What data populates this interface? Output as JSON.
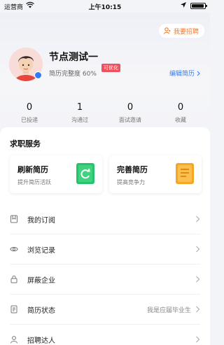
{
  "status_bar": {
    "carrier": "运营商",
    "time": "上午10:15"
  },
  "recruit": {
    "label": "我要招聘"
  },
  "profile": {
    "name": "节点测试一",
    "completeness": "简历完整度 60%",
    "optimize_tag": "可优化",
    "edit_label": "编辑简历"
  },
  "stats": [
    {
      "value": "0",
      "label": "已投递"
    },
    {
      "value": "1",
      "label": "沟通过"
    },
    {
      "value": "0",
      "label": "面试邀请"
    },
    {
      "value": "0",
      "label": "收藏"
    }
  ],
  "services": {
    "title": "求职服务",
    "items": [
      {
        "title": "刷新简历",
        "subtitle": "提升简历活跃",
        "icon": "refresh-icon",
        "color": "#27c26c"
      },
      {
        "title": "完善简历",
        "subtitle": "提高竞争力",
        "icon": "resume-doc-icon",
        "color": "#f5a623"
      }
    ]
  },
  "menu": [
    {
      "label": "我的订阅",
      "icon": "bookmark-icon",
      "value": ""
    },
    {
      "label": "浏览记录",
      "icon": "eye-icon",
      "value": ""
    },
    {
      "label": "屏蔽企业",
      "icon": "lock-icon",
      "value": ""
    },
    {
      "label": "简历状态",
      "icon": "document-icon",
      "value": "我是应届毕业生"
    },
    {
      "label": "招聘达人",
      "icon": "user-badge-icon",
      "value": ""
    }
  ]
}
